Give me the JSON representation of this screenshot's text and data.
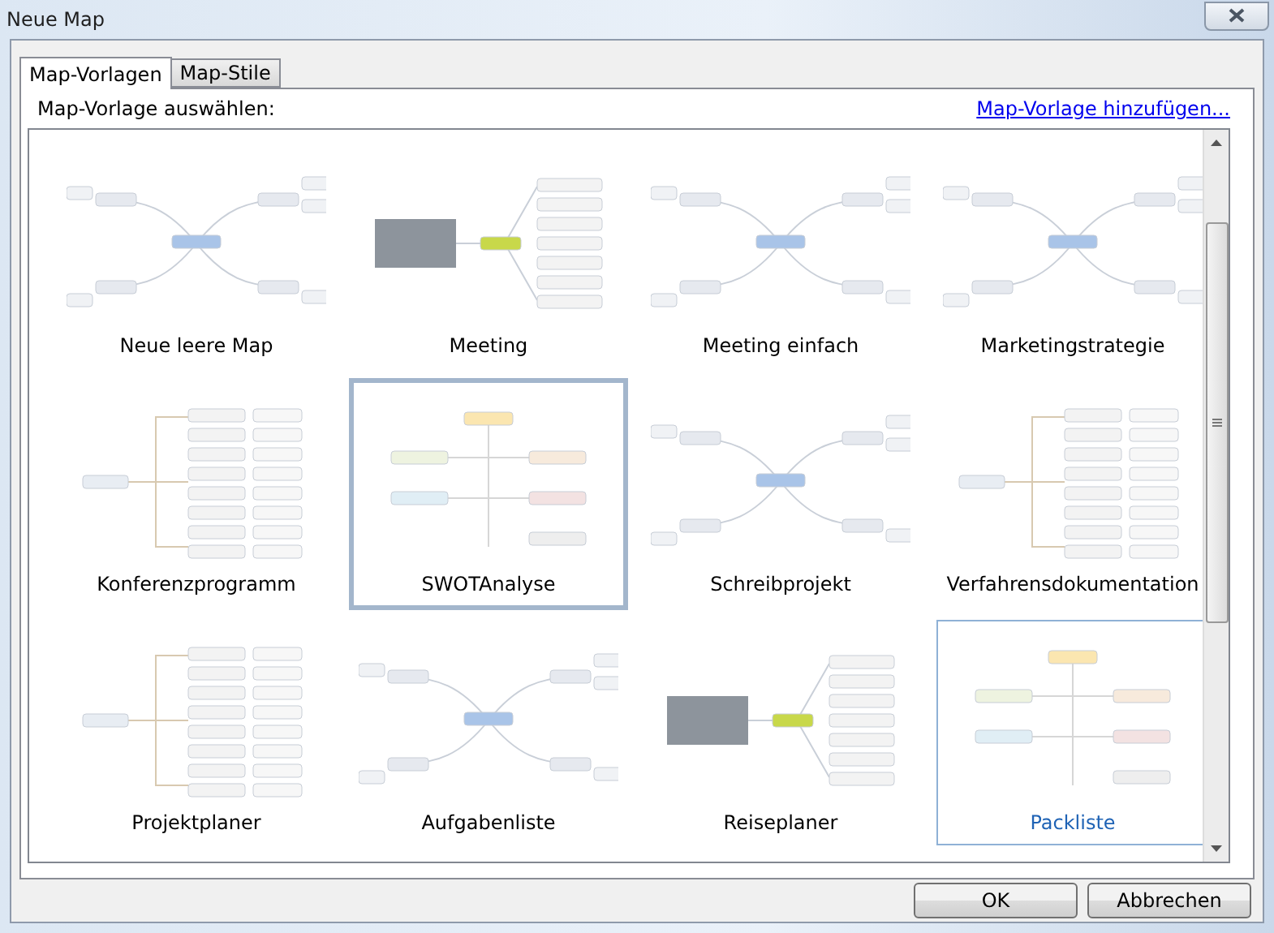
{
  "window": {
    "title": "Neue Map"
  },
  "tabs": [
    {
      "label": "Map-Vorlagen",
      "selected": true
    },
    {
      "label": "Map-Stile",
      "selected": false
    }
  ],
  "prompt": "Map-Vorlage auswählen:",
  "add_link": "Map-Vorlage hinzufügen...",
  "templates": [
    {
      "label": "Neue leere Map",
      "kind": "radial",
      "selected": false,
      "hovered": false
    },
    {
      "label": "Meeting",
      "kind": "list",
      "selected": false,
      "hovered": false
    },
    {
      "label": "Meeting einfach",
      "kind": "radial",
      "selected": false,
      "hovered": false
    },
    {
      "label": "Marketingstrategie",
      "kind": "radial",
      "selected": false,
      "hovered": false
    },
    {
      "label": "Konferenzprogramm",
      "kind": "tree",
      "selected": false,
      "hovered": false
    },
    {
      "label": "SWOTAnalyse",
      "kind": "grid",
      "selected": true,
      "hovered": false
    },
    {
      "label": "Schreibprojekt",
      "kind": "radial",
      "selected": false,
      "hovered": false
    },
    {
      "label": "Verfahrensdokumentation",
      "kind": "tree",
      "selected": false,
      "hovered": false
    },
    {
      "label": "Projektplaner",
      "kind": "tree",
      "selected": false,
      "hovered": false
    },
    {
      "label": "Aufgabenliste",
      "kind": "radial",
      "selected": false,
      "hovered": false
    },
    {
      "label": "Reiseplaner",
      "kind": "list",
      "selected": false,
      "hovered": false
    },
    {
      "label": "Packliste",
      "kind": "grid",
      "selected": false,
      "hovered": true
    }
  ],
  "buttons": [
    {
      "label": "OK"
    },
    {
      "label": "Abbrechen"
    }
  ]
}
